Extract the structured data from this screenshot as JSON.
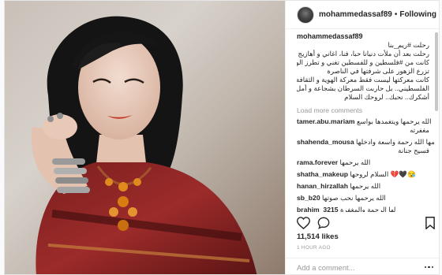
{
  "post": {
    "username": "mohammedassaf89",
    "separator": "•",
    "follow_label": "Following"
  },
  "caption": {
    "username": "mohammedassaf89",
    "lines": [
      "رحلت #ريم_بنا",
      "رحلت بعد أن ملأت دنيانا حبا، فنا، اغاني و أهازيج",
      "كانت من #فلسطين و للفسطين تغني و تطرز الوسادات و",
      "تزرع الزهور على شرفتها في الناصرة",
      "كانت معركتها ليست فقط معركة الهوية و الثقافة و الفن",
      "الفلسطيني.. بل حاربت السرطان بشجاعة و أمل و تحدي",
      "أشكرك.. نحبك.. لروحك السلام"
    ]
  },
  "load_more_label": "Load more comments",
  "comments": [
    {
      "user": "tamer.abu.mariam",
      "text": "الله يرحمها ويتغمدها بواسع",
      "text2": "مغفرته"
    },
    {
      "user": "shahenda_mousa",
      "text": "رحمها الله رحمة واسعة وادخلها",
      "text2": "فسيح جنانة"
    },
    {
      "user": "rama.forever",
      "text": "الله يرحمها"
    },
    {
      "user": "shatha_makeup",
      "text": "السلام لروحها 💔🖤😪"
    },
    {
      "user": "hanan_hirzallah",
      "text": "الله يرحمها"
    },
    {
      "user": "sb_b20",
      "text": "الله يرحمها نحب صوتها"
    },
    {
      "user": "brahim_3215",
      "text": "لها الرحمة والمغفرة"
    }
  ],
  "likes": {
    "count": "11,514",
    "label": "likes"
  },
  "timestamp": "1 HOUR AGO",
  "add_comment": {
    "placeholder": "Add a comment..."
  },
  "icons": [
    "heart-icon",
    "comment-icon",
    "bookmark-icon",
    "more-icon"
  ]
}
